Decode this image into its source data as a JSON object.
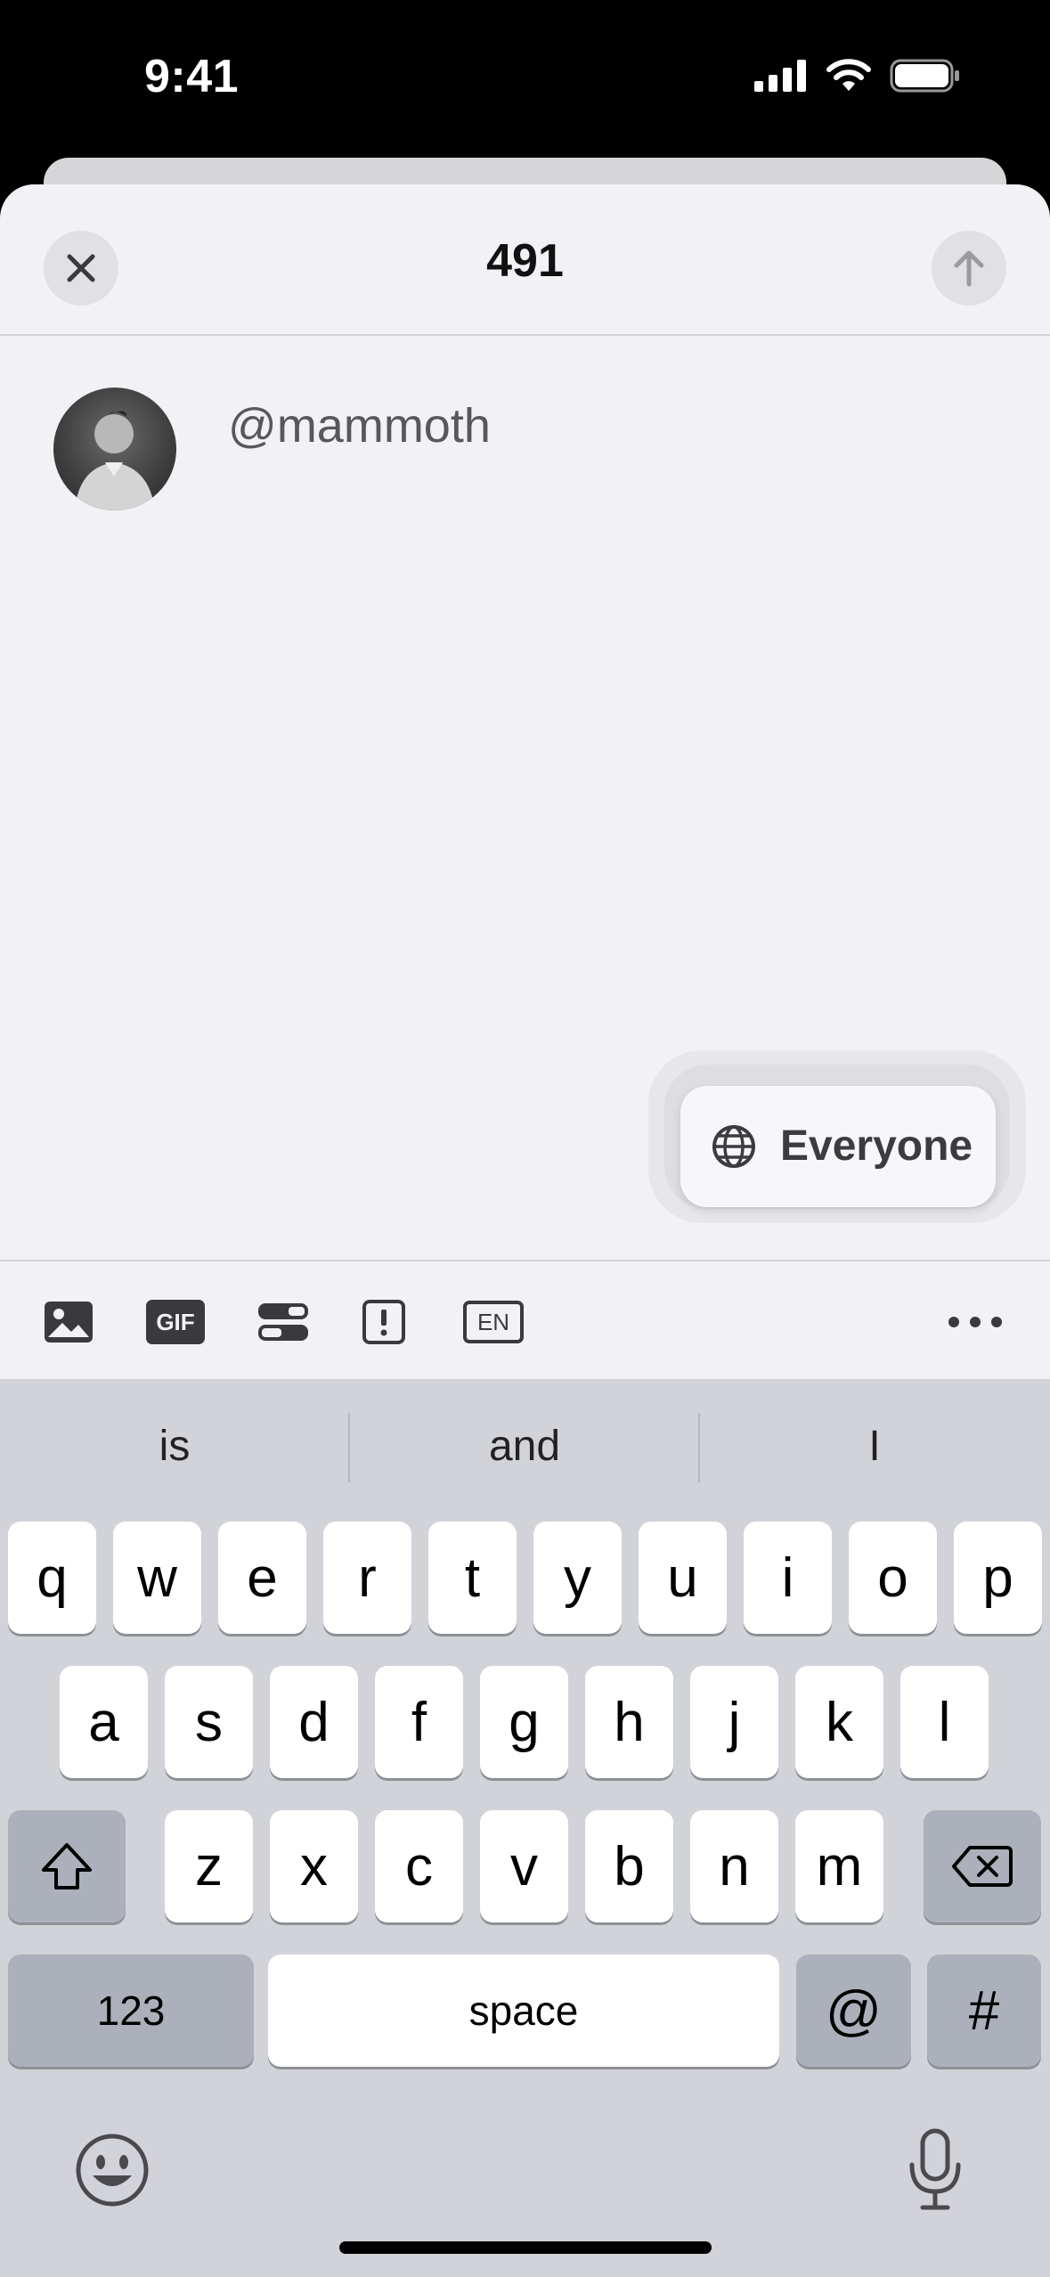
{
  "status_bar": {
    "time": "9:41"
  },
  "header": {
    "char_count": "491"
  },
  "compose": {
    "text": "@mammoth"
  },
  "visibility": {
    "label": "Everyone"
  },
  "toolbar": {
    "gif_label": "GIF",
    "language_label": "EN"
  },
  "suggestions": [
    "is",
    "and",
    "I"
  ],
  "keyboard": {
    "row1": [
      "q",
      "w",
      "e",
      "r",
      "t",
      "y",
      "u",
      "i",
      "o",
      "p"
    ],
    "row2": [
      "a",
      "s",
      "d",
      "f",
      "g",
      "h",
      "j",
      "k",
      "l"
    ],
    "row3": [
      "z",
      "x",
      "c",
      "v",
      "b",
      "n",
      "m"
    ],
    "numbers_label": "123",
    "space_label": "space",
    "at_label": "@",
    "hash_label": "#"
  },
  "colors": {
    "sheet_bg": "#f2f2f6",
    "keyboard_bg": "#d1d3d9",
    "key_bg": "#ffffff",
    "dark_key_bg": "#abb0ba"
  }
}
